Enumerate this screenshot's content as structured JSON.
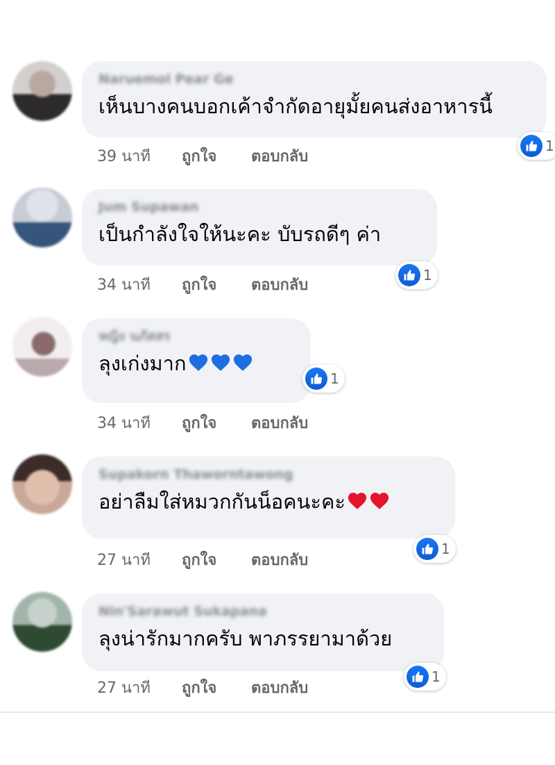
{
  "comments": [
    {
      "author": "Naruemol Pear Ge",
      "text": "เห็นบางคนบอกเค้าจำกัดอายุมั้ยคนส่งอาหารนี้",
      "emoji": "",
      "time": "39 นาที",
      "like_label": "ถูกใจ",
      "reply_label": "ตอบกลับ",
      "reaction_count": "1",
      "avatar_colors": [
        "#c9c2c0",
        "#3b3536"
      ]
    },
    {
      "author": "Jum Supawan",
      "text": "เป็นกำลังใจให้นะคะ บับรถดีๆ ค่า",
      "emoji": "",
      "time": "34 นาที",
      "like_label": "ถูกใจ",
      "reply_label": "ตอบกลับ",
      "reaction_count": "1",
      "avatar_colors": [
        "#c8ccd6",
        "#3e5878"
      ]
    },
    {
      "author": "หญิง นภัสสร",
      "text": "ลุงเก่งมาก",
      "emoji": "blue-heart",
      "emoji_count": 3,
      "emoji_color": "#1d6fe0",
      "time": "34 นาที",
      "like_label": "ถูกใจ",
      "reply_label": "ตอบกลับ",
      "reaction_count": "1",
      "avatar_colors": [
        "#f1ebee",
        "#6d4f52"
      ]
    },
    {
      "author": "Supakorn Thaworntawong",
      "text": "อย่าลืมใส่หมวกกันน็อคนะคะ",
      "emoji": "red-heart",
      "emoji_count": 2,
      "emoji_color": "#e3152b",
      "time": "27 นาที",
      "like_label": "ถูกใจ",
      "reply_label": "ตอบกลับ",
      "reaction_count": "1",
      "avatar_colors": [
        "#d8b7a6",
        "#3a2a26"
      ]
    },
    {
      "author": "Nin'Sarawut Sukapana",
      "text": "ลุงน่ารักมากครับ พาภรรยามาด้วย",
      "emoji": "",
      "time": "27 นาที",
      "like_label": "ถูกใจ",
      "reply_label": "ตอบกลับ",
      "reaction_count": "1",
      "avatar_colors": [
        "#9fb1a7",
        "#34503a"
      ]
    }
  ]
}
